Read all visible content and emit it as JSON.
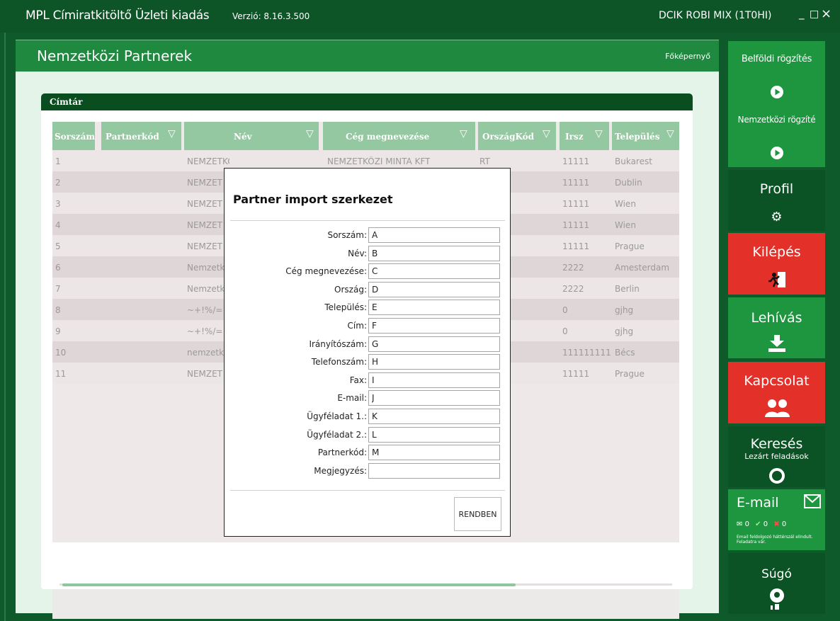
{
  "titlebar": {
    "app_title": "MPL Címiratkitöltő Üzleti kiadás",
    "version": "Verzió: 8.16.3.500",
    "user": "DCIK ROBI MIX (1T0HI)",
    "minimize": "_",
    "maximize": "□",
    "close": "×"
  },
  "panel": {
    "title": "Nemzetközi Partnerek",
    "home_link": "Főképernyő"
  },
  "card": {
    "title": "Címtár"
  },
  "table": {
    "columns": [
      "Sorszám",
      "Partnerkód",
      "Név",
      "Cég megnevezése",
      "OrszágKód",
      "Irsz",
      "Település"
    ],
    "rows": [
      {
        "sorszam": "1",
        "nev": "NEMZETKÖZI CÍMZETT",
        "ceg": "NEMZETKÖZI MINTA KFT",
        "orszag": "RT",
        "irsz": "11111",
        "telepules": "Bukarest"
      },
      {
        "sorszam": "2",
        "nev": "NEMZET",
        "ceg": "",
        "orszag": "",
        "irsz": "11111",
        "telepules": "Dublin"
      },
      {
        "sorszam": "3",
        "nev": "NEMZET",
        "ceg": "",
        "orszag": "",
        "irsz": "11111",
        "telepules": "Wien"
      },
      {
        "sorszam": "4",
        "nev": "NEMZET",
        "ceg": "",
        "orszag": "",
        "irsz": "11111",
        "telepules": "Wien"
      },
      {
        "sorszam": "5",
        "nev": "NEMZET",
        "ceg": "",
        "orszag": "",
        "irsz": "11111",
        "telepules": "Prague"
      },
      {
        "sorszam": "6",
        "nev": "Nemzetk",
        "ceg": "",
        "orszag": "",
        "irsz": "2222",
        "telepules": "Amesterdam"
      },
      {
        "sorszam": "7",
        "nev": "Nemzetk",
        "ceg": "",
        "orszag": "",
        "irsz": "2222",
        "telepules": "Berlin"
      },
      {
        "sorszam": "8",
        "nev": "~+!%/=",
        "ceg": "",
        "orszag": "",
        "irsz": "0",
        "telepules": "gjhg"
      },
      {
        "sorszam": "9",
        "nev": "~+!%/=",
        "ceg": "",
        "orszag": "",
        "irsz": "0",
        "telepules": "gjhg"
      },
      {
        "sorszam": "10",
        "nev": "nemzetk",
        "ceg": "",
        "orszag": "",
        "irsz": "111111111",
        "telepules": "Bécs"
      },
      {
        "sorszam": "11",
        "nev": "NEMZET",
        "ceg": "",
        "orszag": "",
        "irsz": "11111",
        "telepules": "Prague"
      }
    ]
  },
  "dialog": {
    "title": "Partner import szerkezet",
    "fields": [
      {
        "label": "Sorszám:",
        "value": "A"
      },
      {
        "label": "Név:",
        "value": "B"
      },
      {
        "label": "Cég megnevezése:",
        "value": "C"
      },
      {
        "label": "Ország:",
        "value": "D"
      },
      {
        "label": "Település:",
        "value": "E"
      },
      {
        "label": "Cím:",
        "value": "F"
      },
      {
        "label": "Irányítószám:",
        "value": "G"
      },
      {
        "label": "Telefonszám:",
        "value": "H"
      },
      {
        "label": "Fax:",
        "value": "I"
      },
      {
        "label": "E-mail:",
        "value": "J"
      },
      {
        "label": "Ügyféladat 1.:",
        "value": "K"
      },
      {
        "label": "Ügyféladat 2.:",
        "value": "L"
      },
      {
        "label": "Partnerkód:",
        "value": "M"
      },
      {
        "label": "Megjegyzés:",
        "value": ""
      }
    ],
    "ok_label": "RENDBEN"
  },
  "sidebar": {
    "belfoldi": "Belföldi rögzítés",
    "nemzetkozi": "Nemzetközi rögzíté",
    "profil": "Profil",
    "kilepes": "Kilépés",
    "lehivas": "Lehívás",
    "kapcsolat": "Kapcsolat",
    "kereses": "Keresés",
    "kereses_sub": "Lezárt feladások",
    "email": "E-mail",
    "email_count_1": "0",
    "email_count_2": "0",
    "email_count_3": "0",
    "email_note": "Email feldolgozó háttérszál elindult. Feladatra vár.",
    "sugo": "Súgó",
    "colors": {
      "dark": "#0b5224",
      "green": "#1d963f",
      "red": "#e3312a"
    }
  }
}
